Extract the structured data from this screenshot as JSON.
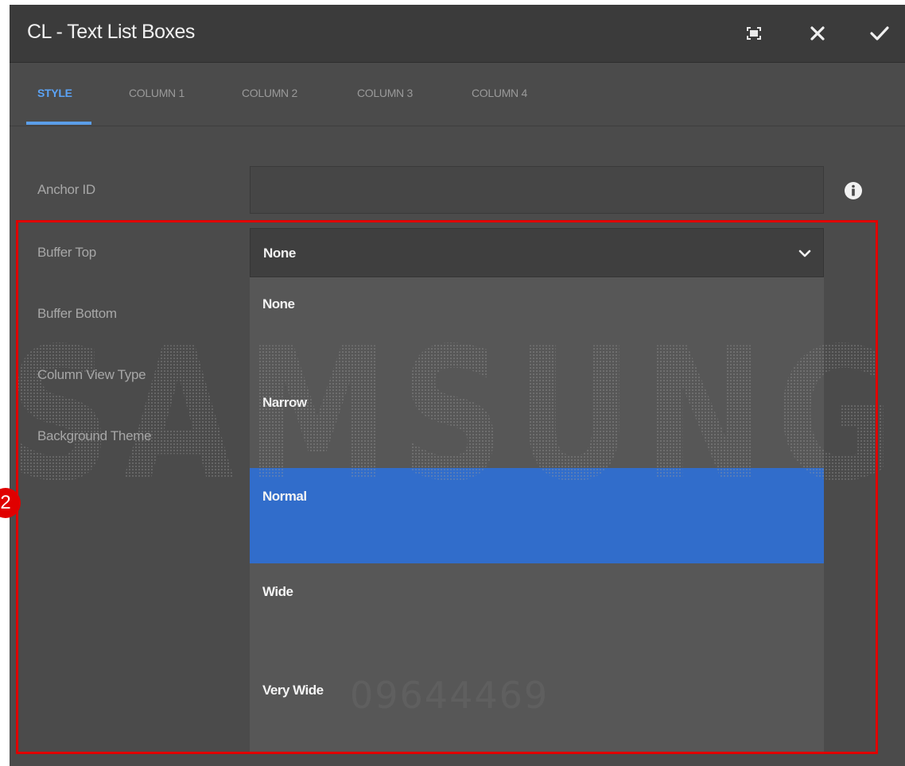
{
  "dialog": {
    "title": "CL - Text List Boxes",
    "toolbar": {
      "fullscreen_icon": "fullscreen-icon",
      "close_icon": "close-icon",
      "confirm_icon": "check-icon"
    }
  },
  "tabs": [
    {
      "label": "STYLE",
      "active": true
    },
    {
      "label": "COLUMN 1",
      "active": false
    },
    {
      "label": "COLUMN 2",
      "active": false
    },
    {
      "label": "COLUMN 3",
      "active": false
    },
    {
      "label": "COLUMN 4",
      "active": false
    }
  ],
  "form": {
    "anchor_id": {
      "label": "Anchor ID",
      "value": ""
    },
    "buffer_top": {
      "label": "Buffer Top",
      "value": "None"
    },
    "buffer_bottom": {
      "label": "Buffer Bottom"
    },
    "column_view_type": {
      "label": "Column View Type"
    },
    "background_theme": {
      "label": "Background Theme"
    }
  },
  "dropdown": {
    "options": [
      "None",
      "Narrow",
      "Normal",
      "Wide",
      "Very Wide"
    ],
    "highlighted": "Normal"
  },
  "annotation": {
    "step_number": "2",
    "color": "#e00000"
  },
  "watermark": {
    "brand": "SAMSUNG",
    "number": "09644469"
  },
  "colors": {
    "accent": "#5ba3f5",
    "selected_option": "#316dcb",
    "dialog_bg": "#4b4b4b",
    "titlebar_bg": "#3b3b3b"
  }
}
